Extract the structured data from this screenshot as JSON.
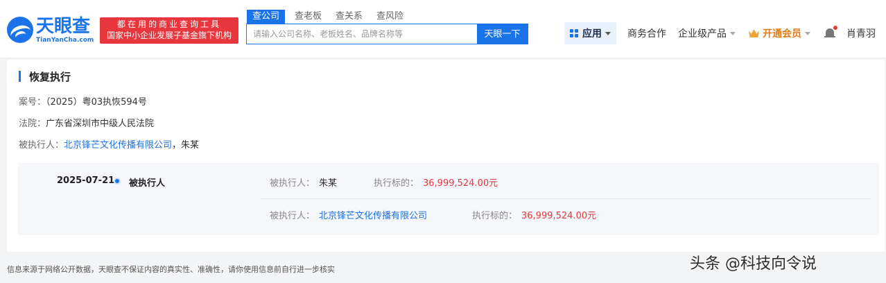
{
  "header": {
    "logo_cn": "天眼查",
    "logo_en": "TianYanCha.com",
    "slogan_line1": "都在用的商业查询工具",
    "slogan_line2": "国家中小企业发展子基金旗下机构"
  },
  "search": {
    "tabs": [
      "查公司",
      "查老板",
      "查关系",
      "查风险"
    ],
    "placeholder": "请输入公司名称、老板姓名、品牌名称等",
    "button": "天眼一下"
  },
  "nav": {
    "app": "应用",
    "business": "商务合作",
    "enterprise": "企业级产品",
    "vip": "开通会员",
    "user": "肖青羽"
  },
  "section": {
    "title": "恢复执行",
    "case_label": "案号：",
    "case_value": "（2025）粤03执恢594号",
    "court_label": "法院：",
    "court_value": "广东省深圳市中级人民法院",
    "respondent_label": "被执行人：",
    "respondent_company": "北京锋芒文化传播有限公司",
    "respondent_sep": "，",
    "respondent_person": "朱某"
  },
  "exec": {
    "date": "2025-07-21",
    "type": "被执行人",
    "rows": [
      {
        "respondent_label": "被执行人：",
        "respondent": "朱某",
        "target_label": "执行标的：",
        "target": "36,999,524.00元"
      },
      {
        "respondent_label": "被执行人：",
        "respondent": "北京锋芒文化传播有限公司",
        "target_label": "执行标的：",
        "target": "36,999,524.00元"
      }
    ]
  },
  "footer": {
    "note": "信息来源于网络公开数据，天眼查不保证内容的真实性、准确性，请你使用信息前自行进一步核实"
  },
  "watermark": "头条 @科技向令说",
  "colors": {
    "brand": "#1a73e8",
    "danger": "#e8363d",
    "vip": "#e07a16"
  }
}
